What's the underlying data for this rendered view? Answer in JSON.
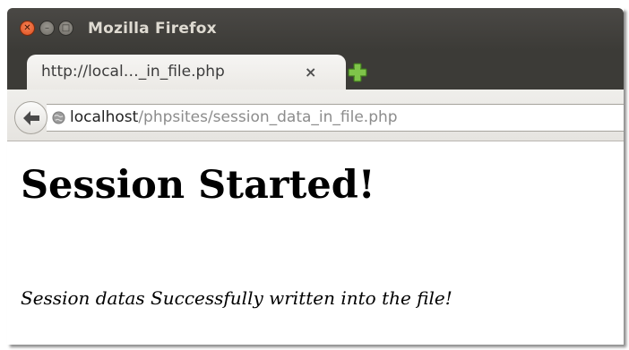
{
  "window": {
    "title": "Mozilla Firefox"
  },
  "tab": {
    "title": "http://local…_in_file.php",
    "close_glyph": "×"
  },
  "urlbar": {
    "host": "localhost",
    "path": "/phpsites/session_data_in_file.php"
  },
  "page": {
    "heading": "Session Started!",
    "message": "Session datas Successfully written into the file!"
  },
  "colors": {
    "titlebar": "#3c3b37",
    "close_button": "#e2552a",
    "new_tab_plus": "#6fb23b",
    "url_path": "#8c8c8c"
  },
  "icons": {
    "close": "close-icon",
    "minimize": "minimize-icon",
    "maximize": "maximize-icon",
    "new_tab": "plus-icon",
    "back": "back-arrow-icon",
    "site": "globe-icon"
  }
}
